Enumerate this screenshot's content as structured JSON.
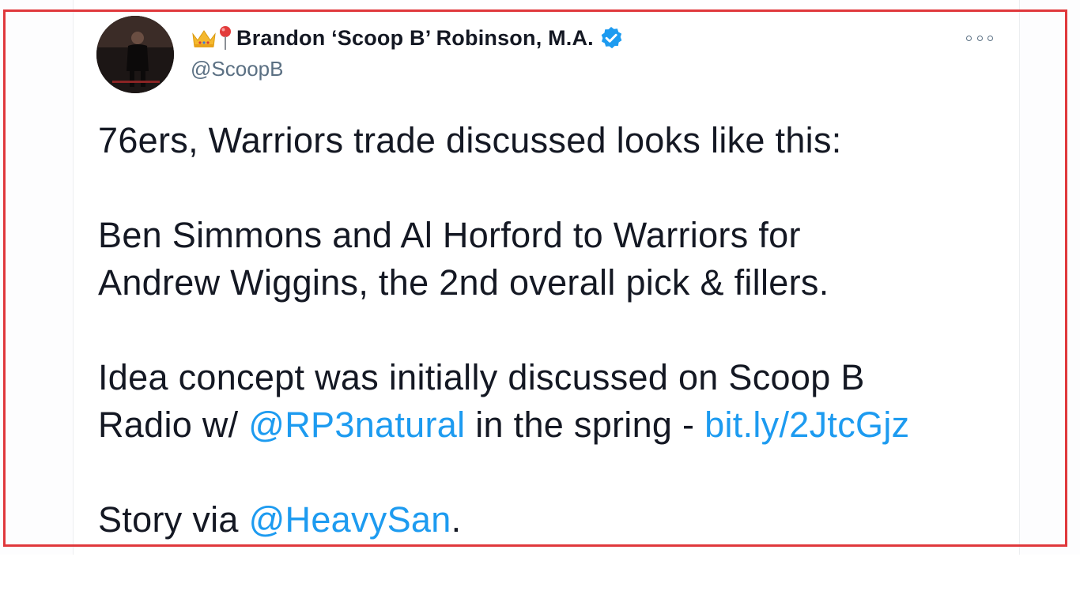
{
  "tweet": {
    "author": {
      "emoji_1": "crown-emoji",
      "emoji_2": "pin-emoji",
      "display_name": "Brandon ‘Scoop B’ Robinson, M.A.",
      "verified": true,
      "handle": "@ScoopB"
    },
    "body": {
      "p1": "76ers, Warriors trade discussed looks like this:",
      "p2_line1": "Ben Simmons and Al Horford to Warriors for",
      "p2_line2": "Andrew Wiggins, the 2nd overall pick & fillers.",
      "p3_line1": "Idea concept was initially discussed on Scoop B",
      "p3_line2_prefix": "Radio w/ ",
      "p3_mention": "@RP3natural",
      "p3_line2_middle": " in the spring  - ",
      "p3_link": "bit.ly/2JtcGjz",
      "p4_prefix": "Story via ",
      "p4_mention": "@HeavySan",
      "p4_suffix": "."
    }
  },
  "colors": {
    "text": "#141823",
    "secondary": "#5b7083",
    "link": "#1d9bf0",
    "verified": "#1d9bf0",
    "highlight": "#e0383c"
  }
}
